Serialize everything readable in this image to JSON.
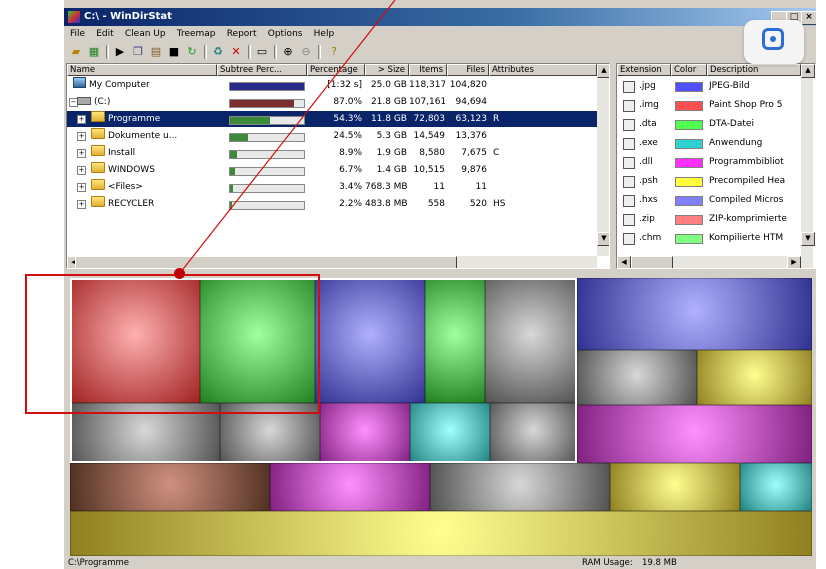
{
  "window": {
    "title": "C:\\ - WinDirStat"
  },
  "menu": [
    "File",
    "Edit",
    "Clean Up",
    "Treemap",
    "Report",
    "Options",
    "Help"
  ],
  "toolbar": {
    "icons": [
      "open-icon",
      "refresh-icon",
      "play-icon",
      "copy-icon",
      "explorer-icon",
      "cmd-icon",
      "refresh-selected-icon",
      "recycle-icon",
      "delete-icon",
      "properties-icon",
      "zoom-in-icon",
      "zoom-out-icon",
      "help-icon"
    ]
  },
  "dir_list": {
    "headers": [
      "Name",
      "Subtree Perc...",
      "Percentage",
      "> Size",
      "Items",
      "Files",
      "Attributes"
    ],
    "rows": [
      {
        "name": "My Computer",
        "bar": 1.0,
        "bar_color": "#2a2a8a",
        "pct": "[1:32 s]",
        "size": "25.0 GB",
        "items": "118,317",
        "files": "104,820",
        "attr": ""
      },
      {
        "name": "(C:)",
        "bar": 0.87,
        "bar_color": "#7a3030",
        "pct": "87.0%",
        "size": "21.8 GB",
        "items": "107,161",
        "files": "94,694",
        "attr": ""
      },
      {
        "name": "Programme",
        "bar": 0.543,
        "bar_color": "#3a8a3a",
        "pct": "54.3%",
        "size": "11.8 GB",
        "items": "72,803",
        "files": "63,123",
        "attr": "R",
        "selected": true
      },
      {
        "name": "Dokumente u...",
        "bar": 0.245,
        "bar_color": "#3a8a3a",
        "pct": "24.5%",
        "size": "5.3 GB",
        "items": "14,549",
        "files": "13,376",
        "attr": ""
      },
      {
        "name": "Install",
        "bar": 0.089,
        "bar_color": "#3a8a3a",
        "pct": "8.9%",
        "size": "1.9 GB",
        "items": "8,580",
        "files": "7,675",
        "attr": "C"
      },
      {
        "name": "WINDOWS",
        "bar": 0.067,
        "bar_color": "#3a8a3a",
        "pct": "6.7%",
        "size": "1.4 GB",
        "items": "10,515",
        "files": "9,876",
        "attr": ""
      },
      {
        "name": "<Files>",
        "bar": 0.034,
        "bar_color": "#3a8a3a",
        "pct": "3.4%",
        "size": "768.3 MB",
        "items": "11",
        "files": "11",
        "attr": ""
      },
      {
        "name": "RECYCLER",
        "bar": 0.022,
        "bar_color": "#3a8a3a",
        "pct": "2.2%",
        "size": "483.8 MB",
        "items": "558",
        "files": "520",
        "attr": "HS"
      }
    ]
  },
  "ext_list": {
    "headers": [
      "Extension",
      "Color",
      "Description"
    ],
    "rows": [
      {
        "ext": ".jpg",
        "color": "#5050ff",
        "desc": "JPEG-Bild"
      },
      {
        "ext": ".img",
        "color": "#ff5050",
        "desc": "Paint Shop Pro 5"
      },
      {
        "ext": ".dta",
        "color": "#50ff50",
        "desc": "DTA-Datei"
      },
      {
        "ext": ".exe",
        "color": "#30d0d0",
        "desc": "Anwendung"
      },
      {
        "ext": ".dll",
        "color": "#ff30ff",
        "desc": "Programmbibliot"
      },
      {
        "ext": ".psh",
        "color": "#ffff40",
        "desc": "Precompiled Hea"
      },
      {
        "ext": ".hxs",
        "color": "#8080ff",
        "desc": "Compiled Micros"
      },
      {
        "ext": ".zip",
        "color": "#ff8080",
        "desc": "ZIP-komprimierte"
      },
      {
        "ext": ".chm",
        "color": "#80ff80",
        "desc": "Kompilierte HTM"
      }
    ]
  },
  "status": {
    "path": "C:\\Programme",
    "ram_label": "RAM Usage:",
    "ram_value": "19.8 MB"
  }
}
